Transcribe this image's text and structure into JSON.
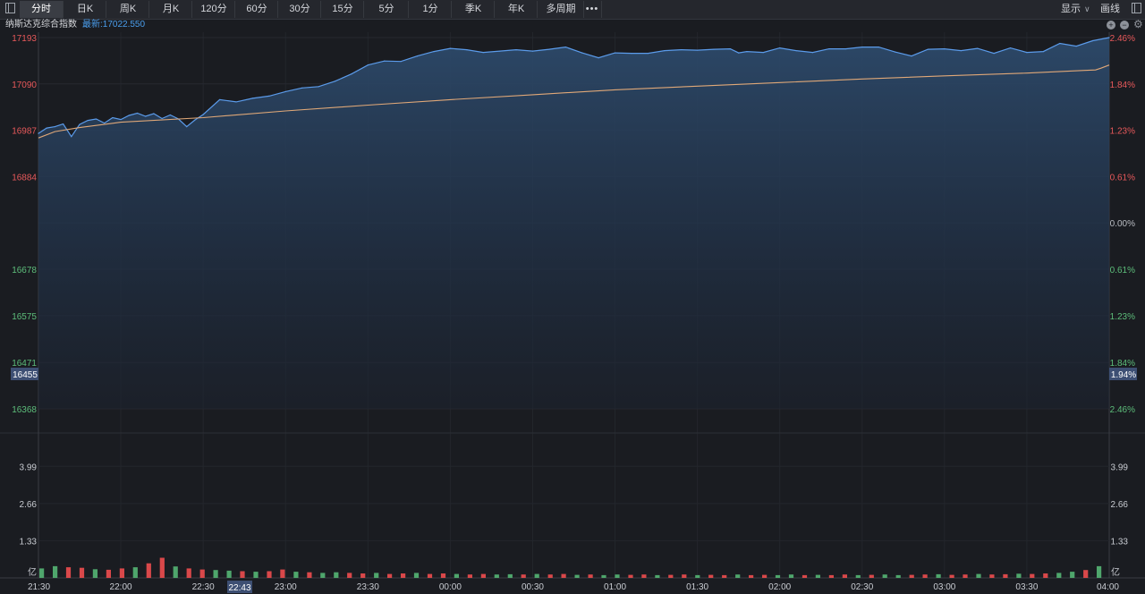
{
  "toolbar": {
    "tabs": [
      "分时",
      "日K",
      "周K",
      "月K",
      "120分",
      "60分",
      "30分",
      "15分",
      "5分",
      "1分",
      "季K",
      "年K",
      "多周期"
    ],
    "active": "分时",
    "more": "•••",
    "display_label": "显示",
    "draw_label": "画线"
  },
  "header": {
    "index_name": "纳斯达克综合指数",
    "latest": "最新:17022.550"
  },
  "cursor": {
    "price_label": "16455",
    "pct_label": "1.94%",
    "time_label": "22:43"
  },
  "chart_data": [
    {
      "type": "line",
      "ylim": [
        16368,
        17193
      ],
      "grid": true,
      "price_ticks": [
        {
          "value": 17193,
          "label": "17193",
          "pct": "2.46%",
          "dir": "up"
        },
        {
          "value": 17090,
          "label": "17090",
          "pct": "1.84%",
          "dir": "up"
        },
        {
          "value": 16987,
          "label": "16987",
          "pct": "1.23%",
          "dir": "up"
        },
        {
          "value": 16884,
          "label": "16884",
          "pct": "0.61%",
          "dir": "up"
        },
        {
          "value": 16781,
          "label": "",
          "pct": "0.00%",
          "dir": "flat"
        },
        {
          "value": 16678,
          "label": "16678",
          "pct": "0.61%",
          "dir": "down"
        },
        {
          "value": 16575,
          "label": "16575",
          "pct": "1.23%",
          "dir": "down"
        },
        {
          "value": 16471,
          "label": "16471",
          "pct": "1.84%",
          "dir": "down"
        },
        {
          "value": 16368,
          "label": "16368",
          "pct": "2.46%",
          "dir": "down"
        }
      ],
      "x_ticks": [
        "21:30",
        "22:00",
        "22:30",
        "23:00",
        "23:30",
        "00:00",
        "00:30",
        "01:00",
        "01:30",
        "02:00",
        "02:30",
        "03:00",
        "03:30",
        "04:00"
      ],
      "series": [
        {
          "role": "price",
          "color": "#5b9bea",
          "x": [
            0,
            3,
            6,
            9,
            12,
            15,
            18,
            21,
            24,
            27,
            30,
            33,
            36,
            39,
            42,
            45,
            48,
            51,
            54,
            57,
            60,
            66,
            72,
            78,
            84,
            90,
            96,
            102,
            108,
            114,
            120,
            126,
            132,
            138,
            144,
            150,
            156,
            162,
            168,
            174,
            180,
            186,
            192,
            198,
            204,
            210,
            216,
            222,
            228,
            234,
            240,
            246,
            252,
            255,
            258,
            264,
            270,
            276,
            282,
            288,
            294,
            300,
            306,
            312,
            318,
            324,
            330,
            336,
            342,
            348,
            354,
            360,
            366,
            372,
            378,
            384,
            390
          ],
          "values": [
            16980,
            16992,
            16995,
            17001,
            16973,
            17000,
            17009,
            17012,
            17003,
            17015,
            17011,
            17020,
            17025,
            17018,
            17024,
            17013,
            17021,
            17012,
            16995,
            17010,
            17022,
            17055,
            17050,
            17058,
            17063,
            17073,
            17081,
            17084,
            17096,
            17112,
            17132,
            17141,
            17140,
            17152,
            17162,
            17169,
            17166,
            17160,
            17163,
            17166,
            17163,
            17167,
            17172,
            17159,
            17148,
            17159,
            17158,
            17158,
            17164,
            17166,
            17165,
            17167,
            17168,
            17159,
            17162,
            17160,
            17170,
            17164,
            17160,
            17168,
            17168,
            17172,
            17172,
            17161,
            17152,
            17167,
            17168,
            17164,
            17169,
            17158,
            17170,
            17160,
            17162,
            17180,
            17174,
            17186,
            17193
          ]
        },
        {
          "role": "average",
          "color": "#e0a878",
          "x": [
            0,
            6,
            15,
            30,
            60,
            90,
            120,
            150,
            180,
            210,
            240,
            270,
            300,
            330,
            360,
            381,
            385,
            387,
            390
          ],
          "values": [
            16970,
            16984,
            16993,
            17005,
            17015,
            17030,
            17043,
            17055,
            17066,
            17077,
            17085,
            17093,
            17101,
            17108,
            17114,
            17120,
            17121,
            17125,
            17132
          ]
        }
      ]
    },
    {
      "type": "bar",
      "ylim": [
        0,
        4.99
      ],
      "y_ticks": [
        3.99,
        2.66,
        1.33
      ],
      "y_unit": "亿",
      "x_ticks": [
        "21:30",
        "22:00",
        "22:30",
        "23:00",
        "23:30",
        "00:00",
        "00:30",
        "01:00",
        "01:30",
        "02:00",
        "02:30",
        "03:00",
        "03:30",
        "04:00"
      ],
      "colors": {
        "up": "#d9484a",
        "down": "#4fa66c"
      },
      "values": [
        0.34,
        0.42,
        0.38,
        0.36,
        0.31,
        0.29,
        0.34,
        0.38,
        0.52,
        0.72,
        0.41,
        0.34,
        0.3,
        0.28,
        0.26,
        0.24,
        0.22,
        0.24,
        0.3,
        0.22,
        0.2,
        0.18,
        0.2,
        0.18,
        0.16,
        0.18,
        0.14,
        0.16,
        0.18,
        0.14,
        0.16,
        0.14,
        0.12,
        0.14,
        0.12,
        0.13,
        0.12,
        0.14,
        0.12,
        0.14,
        0.11,
        0.12,
        0.1,
        0.12,
        0.11,
        0.12,
        0.1,
        0.11,
        0.12,
        0.1,
        0.11,
        0.1,
        0.12,
        0.1,
        0.11,
        0.1,
        0.12,
        0.1,
        0.11,
        0.1,
        0.12,
        0.1,
        0.11,
        0.12,
        0.1,
        0.11,
        0.12,
        0.13,
        0.11,
        0.12,
        0.14,
        0.12,
        0.13,
        0.15,
        0.14,
        0.16,
        0.18,
        0.22,
        0.28,
        0.42
      ]
    }
  ]
}
